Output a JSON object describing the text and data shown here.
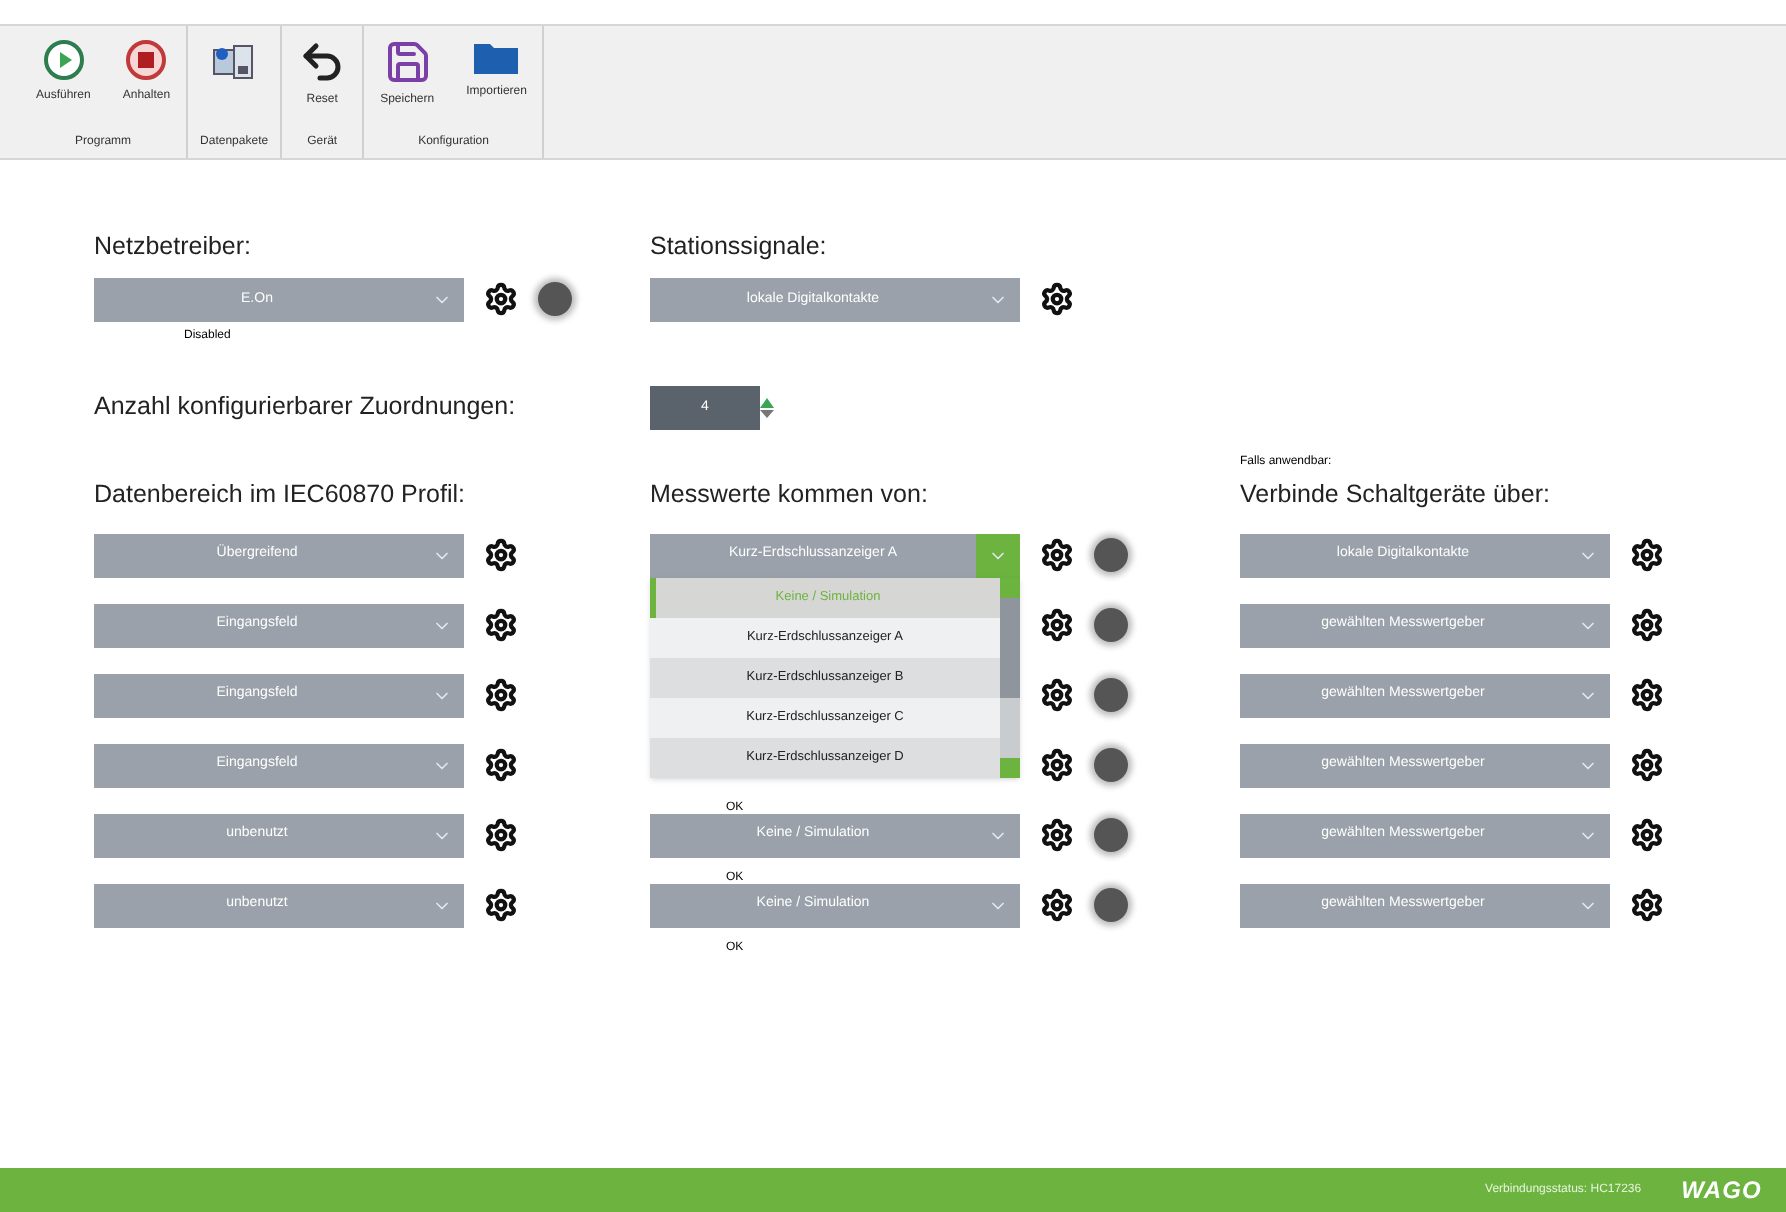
{
  "toolbar": {
    "groups": [
      {
        "label": "Programm",
        "buttons": [
          {
            "kind": "play",
            "label": "Ausführen"
          },
          {
            "kind": "stop",
            "label": "Anhalten"
          }
        ]
      },
      {
        "label": "Datenpakete",
        "buttons": [
          {
            "kind": "packages"
          }
        ]
      },
      {
        "label": "Gerät",
        "buttons": [
          {
            "kind": "reset",
            "label": "Reset"
          }
        ]
      },
      {
        "label": "Konfiguration",
        "buttons": [
          {
            "kind": "save",
            "label": "Speichern"
          },
          {
            "kind": "open",
            "label": "Importieren"
          }
        ]
      }
    ]
  },
  "netzbetreiber": {
    "heading": "Netzbetreiber:",
    "value": "E.On",
    "status": "Disabled"
  },
  "stationssignale": {
    "heading": "Stationssignale:",
    "value": "lokale Digitalkontakte"
  },
  "anzahl": {
    "heading": "Anzahl konfigurierbarer Zuordnungen:",
    "value": "4"
  },
  "datenbereich": {
    "heading": "Datenbereich im IEC60870 Profil:",
    "rows": [
      {
        "value": "Übergreifend"
      },
      {
        "value": "Eingangsfeld"
      },
      {
        "value": "Eingangsfeld"
      },
      {
        "value": "Eingangsfeld"
      },
      {
        "value": "unbenutzt"
      },
      {
        "value": "unbenutzt"
      }
    ]
  },
  "messwerte": {
    "heading": "Messwerte kommen von:",
    "rows": [
      {
        "value": "Kurz-Erdschlussanzeiger A",
        "expanded": true
      },
      {},
      {},
      {
        "status": "OK"
      },
      {
        "value": "Keine / Simulation",
        "status": "OK"
      },
      {
        "value": "Keine / Simulation",
        "status": "OK"
      }
    ],
    "options": [
      {
        "label": "Keine / Simulation",
        "selected": true
      },
      {
        "label": "Kurz-Erdschlussanzeiger A",
        "selected": false
      },
      {
        "label": "Kurz-Erdschlussanzeiger B",
        "selected": false
      },
      {
        "label": "Kurz-Erdschlussanzeiger C",
        "selected": false
      },
      {
        "label": "Kurz-Erdschlussanzeiger D",
        "selected": false
      }
    ]
  },
  "schaltgeraete": {
    "note": "Falls anwendbar:",
    "heading": "Verbinde Schaltgeräte über:",
    "rows": [
      {
        "value": "lokale Digitalkontakte"
      },
      {
        "value": "gewählten Messwertgeber"
      },
      {
        "value": "gewählten Messwertgeber"
      },
      {
        "value": "gewählten Messwertgeber"
      },
      {
        "value": "gewählten Messwertgeber"
      },
      {
        "value": "gewählten Messwertgeber"
      }
    ]
  },
  "status_bar": {
    "text": "Verbindungsstatus: HC17236",
    "logo": "WAGO"
  }
}
